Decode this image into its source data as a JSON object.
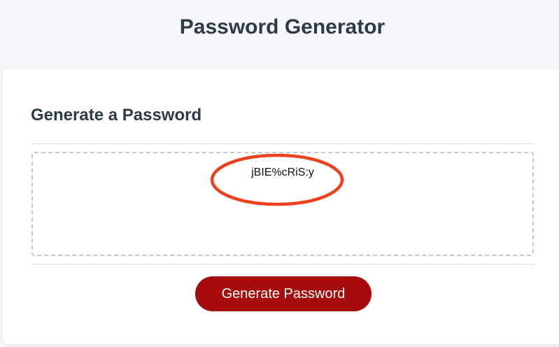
{
  "header": {
    "title": "Password Generator"
  },
  "card": {
    "title": "Generate a Password",
    "password": "jBIE%cRiS:y",
    "generate_label": "Generate Password"
  },
  "colors": {
    "button": "#a60c0c",
    "annotation": "#f0401e",
    "heading": "#2f3a48"
  }
}
